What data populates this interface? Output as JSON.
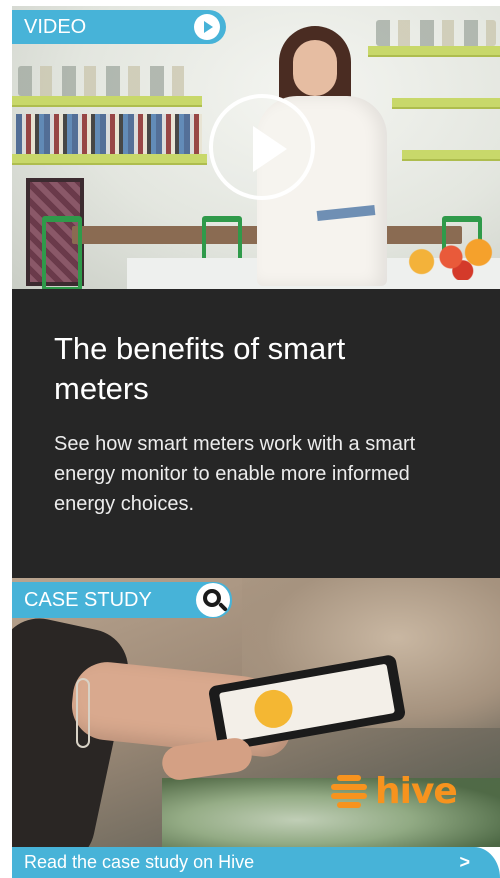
{
  "video_card": {
    "tag_label": "VIDEO",
    "tag_icon": "play-circle-icon",
    "play_icon": "play-button-icon"
  },
  "panel": {
    "title": "The benefits of smart meters",
    "body": "See how smart meters work with a smart energy monitor to enable more informed energy choices."
  },
  "case_card": {
    "tag_label": "CASE STUDY",
    "tag_icon": "search-icon",
    "brand_logo": "hive-logo",
    "brand_word": "hive"
  },
  "cta": {
    "label": "Read the case study on Hive",
    "arrow": ">"
  },
  "colors": {
    "accent": "#47b3d8",
    "panel_bg": "#262626",
    "hive_orange": "#f7931e"
  }
}
